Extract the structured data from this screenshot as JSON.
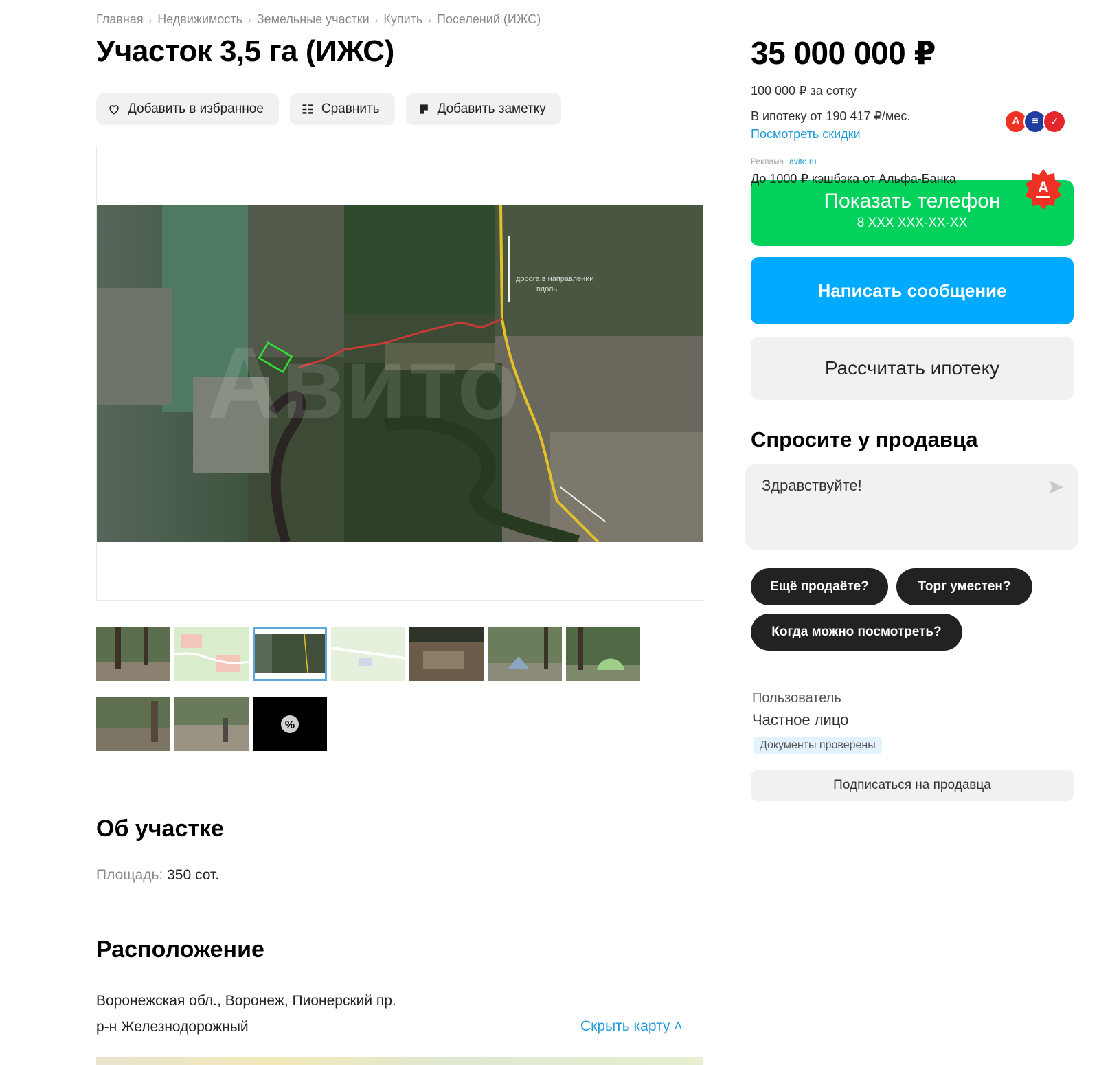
{
  "breadcrumbs": [
    "Главная",
    "Недвижимость",
    "Земельные участки",
    "Купить",
    "Поселений (ИЖС)"
  ],
  "title": "Участок 3,5 га (ИЖС)",
  "actions": {
    "favorite": "Добавить в избранное",
    "compare": "Сравнить",
    "note": "Добавить заметку"
  },
  "gallery": {
    "thumbnail_count": 10,
    "active_thumbnail": 3,
    "map_label_1": "дорога в направлении",
    "map_label_2": "вдоль",
    "map_watermark": "Авито"
  },
  "about": {
    "title": "Об участке",
    "area_label": "Площадь:",
    "area_value": "350 сот."
  },
  "location": {
    "title": "Расположение",
    "address_line1": "Воронежская обл., Воронеж, Пионерский пр.",
    "address_line2": "р-н Железнодорожный",
    "hide_map": "Скрыть карту ˄"
  },
  "sidebar": {
    "price": "35 000 000 ₽",
    "per_unit": "100 000 ₽ за сотку",
    "mortgage": "В ипотеку от 190 417 ₽/мес.",
    "discounts_link": "Посмотреть скидки",
    "ad_label": "Реклама",
    "ad_domain": "avito.ru",
    "ad_text": "До 1000 ₽ кэшбэка от Альфа-Банка",
    "phone_button": "Показать телефон",
    "phone_mask": "8 XXX XXX-XX-XX",
    "message_button": "Написать сообщение",
    "mortgage_button": "Рассчитать ипотеку",
    "ask_title": "Спросите у продавца",
    "ask_placeholder": "Здравствуйте!",
    "chips": [
      "Ещё продаёте?",
      "Торг уместен?",
      "Когда можно посмотреть?"
    ],
    "seller_role": "Пользователь",
    "seller_type": "Частное лицо",
    "verified_badge": "Документы проверены",
    "subscribe_button": "Подписаться на продавца"
  },
  "colors": {
    "green_button": "#02d15c",
    "blue_button": "#00aaff",
    "link": "#1e9bd7",
    "alfa_red": "#ef3124"
  }
}
